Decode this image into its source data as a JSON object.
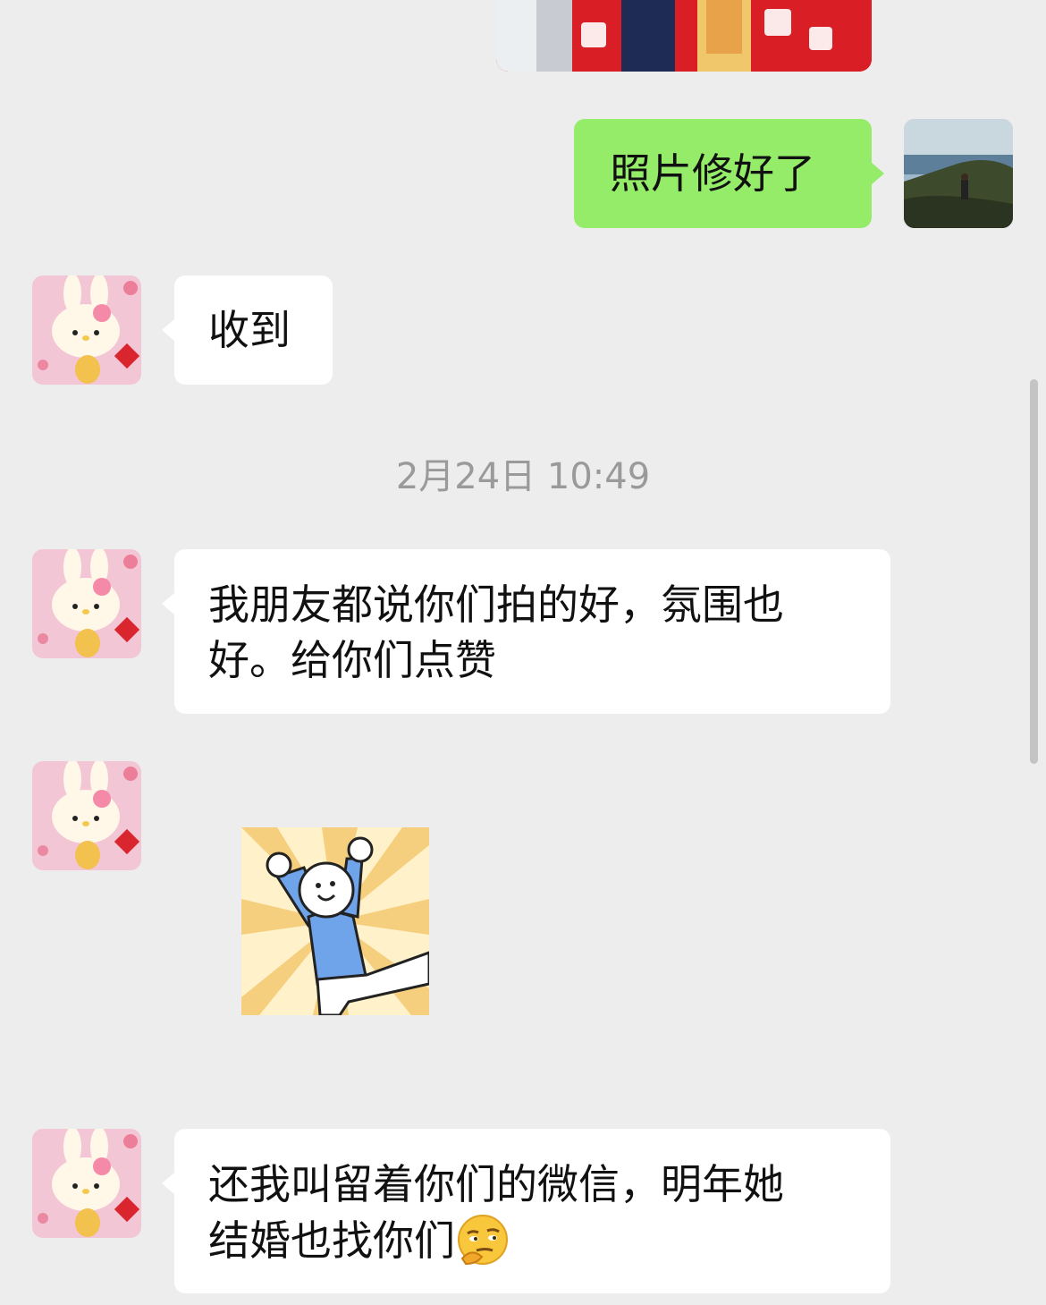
{
  "messages": {
    "outgoing_1": {
      "text": "照片修好了"
    },
    "incoming_1": {
      "text": "收到"
    },
    "timestamp": "2月24日 10:49",
    "incoming_2": {
      "line1": "我朋友都说你们拍的好，氛围也",
      "line2": "好。给你们点赞"
    },
    "incoming_3": {
      "sticker": "cheering-stick-figure-sticker"
    },
    "incoming_4": {
      "line1": "还我叫留着你们的微信，明年她",
      "line2": "结婚也找你们",
      "emoji": "thinking-smirk-emoji"
    }
  },
  "avatars": {
    "self": "landscape-avatar",
    "contact": "hello-kitty-bunny-avatar"
  },
  "colors": {
    "background": "#ededed",
    "outgoing_bubble": "#95ec69",
    "incoming_bubble": "#ffffff",
    "timestamp_text": "#9a9a9a"
  }
}
